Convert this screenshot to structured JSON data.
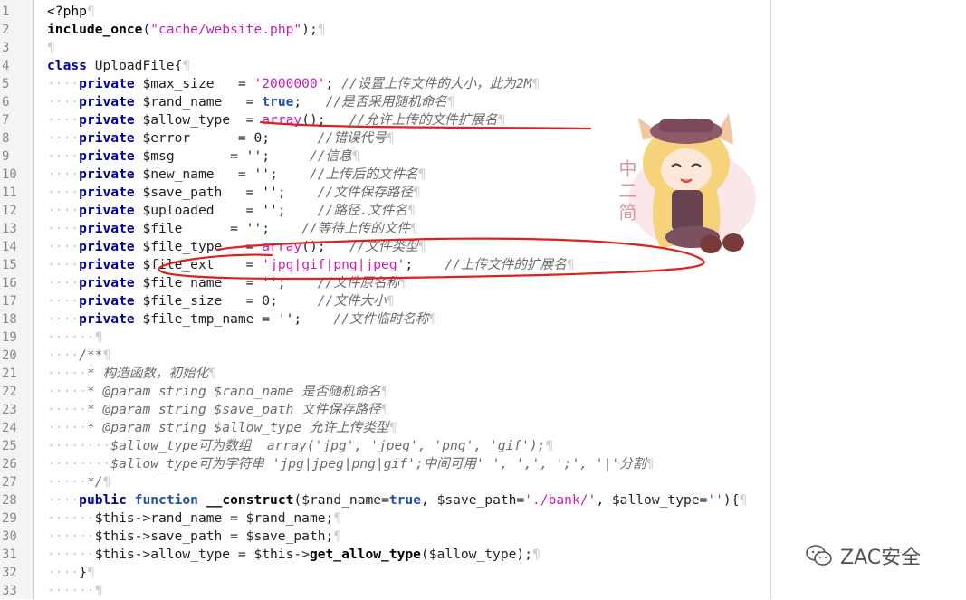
{
  "editor": {
    "lines": [
      {
        "n": "1",
        "segs": [
          [
            "tag",
            "<?php"
          ],
          [
            "pil",
            "¶"
          ]
        ]
      },
      {
        "n": "2",
        "segs": [
          [
            "fn",
            "include_once"
          ],
          [
            "pl",
            "("
          ],
          [
            "str",
            "\"cache/website.php\""
          ],
          [
            "pl",
            ");"
          ],
          [
            "pil",
            "¶"
          ]
        ]
      },
      {
        "n": "3",
        "segs": [
          [
            "pil",
            "¶"
          ]
        ]
      },
      {
        "n": "4",
        "segs": [
          [
            "kw",
            "class"
          ],
          [
            "pl",
            " UploadFile{"
          ],
          [
            "pil",
            "¶"
          ]
        ]
      },
      {
        "n": "5",
        "segs": [
          [
            "ind",
            "····"
          ],
          [
            "kw",
            "private"
          ],
          [
            "pl",
            " $max_size   = "
          ],
          [
            "str",
            "'2000000'"
          ],
          [
            "pl",
            "; "
          ],
          [
            "cmt",
            "//设置上传文件的大小，此为2M"
          ],
          [
            "pil",
            "¶"
          ]
        ]
      },
      {
        "n": "6",
        "segs": [
          [
            "ind",
            "····"
          ],
          [
            "kw",
            "private"
          ],
          [
            "pl",
            " $rand_name   = "
          ],
          [
            "bool",
            "true"
          ],
          [
            "pl",
            ";   "
          ],
          [
            "cmt",
            "//是否采用随机命名"
          ],
          [
            "pil",
            "¶"
          ]
        ]
      },
      {
        "n": "7",
        "segs": [
          [
            "ind",
            "····"
          ],
          [
            "kw",
            "private"
          ],
          [
            "pl",
            " $allow_type  = "
          ],
          [
            "str",
            "array"
          ],
          [
            "pl",
            "();   "
          ],
          [
            "cmt",
            "//允许上传的文件扩展名"
          ],
          [
            "pil",
            "¶"
          ]
        ]
      },
      {
        "n": "8",
        "segs": [
          [
            "ind",
            "····"
          ],
          [
            "kw",
            "private"
          ],
          [
            "pl",
            " $error      = 0;      "
          ],
          [
            "cmt",
            "//错误代号"
          ],
          [
            "pil",
            "¶"
          ]
        ]
      },
      {
        "n": "9",
        "segs": [
          [
            "ind",
            "····"
          ],
          [
            "kw",
            "private"
          ],
          [
            "pl",
            " $msg       = '';     "
          ],
          [
            "cmt",
            "//信息"
          ],
          [
            "pil",
            "¶"
          ]
        ]
      },
      {
        "n": "10",
        "segs": [
          [
            "ind",
            "····"
          ],
          [
            "kw",
            "private"
          ],
          [
            "pl",
            " $new_name   = '';    "
          ],
          [
            "cmt",
            "//上传后的文件名"
          ],
          [
            "pil",
            "¶"
          ]
        ]
      },
      {
        "n": "11",
        "segs": [
          [
            "ind",
            "····"
          ],
          [
            "kw",
            "private"
          ],
          [
            "pl",
            " $save_path   = '';    "
          ],
          [
            "cmt",
            "//文件保存路径"
          ],
          [
            "pil",
            "¶"
          ]
        ]
      },
      {
        "n": "12",
        "segs": [
          [
            "ind",
            "····"
          ],
          [
            "kw",
            "private"
          ],
          [
            "pl",
            " $uploaded    = '';    "
          ],
          [
            "cmt",
            "//路径.文件名"
          ],
          [
            "pil",
            "¶"
          ]
        ]
      },
      {
        "n": "13",
        "segs": [
          [
            "ind",
            "····"
          ],
          [
            "kw",
            "private"
          ],
          [
            "pl",
            " $file      = '';    "
          ],
          [
            "cmt",
            "//等待上传的文件"
          ],
          [
            "pil",
            "¶"
          ]
        ]
      },
      {
        "n": "14",
        "segs": [
          [
            "ind",
            "····"
          ],
          [
            "kw",
            "private"
          ],
          [
            "pl",
            " $file_type   = "
          ],
          [
            "str",
            "array"
          ],
          [
            "pl",
            "();   "
          ],
          [
            "cmt",
            "//文件类型"
          ],
          [
            "pil",
            "¶"
          ]
        ]
      },
      {
        "n": "15",
        "segs": [
          [
            "ind",
            "····"
          ],
          [
            "kw",
            "private"
          ],
          [
            "pl",
            " $file_ext    = "
          ],
          [
            "str",
            "'jpg|gif|png|jpeg'"
          ],
          [
            "pl",
            ";    "
          ],
          [
            "cmt",
            "//上传文件的扩展名"
          ],
          [
            "pil",
            "¶"
          ]
        ]
      },
      {
        "n": "16",
        "segs": [
          [
            "ind",
            "····"
          ],
          [
            "kw",
            "private"
          ],
          [
            "pl",
            " $file_name   = '';    "
          ],
          [
            "cmt",
            "//文件原名称"
          ],
          [
            "pil",
            "¶"
          ]
        ]
      },
      {
        "n": "17",
        "segs": [
          [
            "ind",
            "····"
          ],
          [
            "kw",
            "private"
          ],
          [
            "pl",
            " $file_size   = 0;     "
          ],
          [
            "cmt",
            "//文件大小"
          ],
          [
            "pil",
            "¶"
          ]
        ]
      },
      {
        "n": "18",
        "segs": [
          [
            "ind",
            "····"
          ],
          [
            "kw",
            "private"
          ],
          [
            "pl",
            " $file_tmp_name = '';    "
          ],
          [
            "cmt",
            "//文件临时名称"
          ],
          [
            "pil",
            "¶"
          ]
        ]
      },
      {
        "n": "19",
        "segs": [
          [
            "ind",
            "······"
          ],
          [
            "pil",
            "¶"
          ]
        ]
      },
      {
        "n": "20",
        "segs": [
          [
            "ind",
            "····"
          ],
          [
            "cmt",
            "/**"
          ],
          [
            "pil",
            "¶"
          ]
        ]
      },
      {
        "n": "21",
        "segs": [
          [
            "ind",
            "·····"
          ],
          [
            "cmt",
            "* 构造函数，初始化"
          ],
          [
            "pil",
            "¶"
          ]
        ]
      },
      {
        "n": "22",
        "segs": [
          [
            "ind",
            "·····"
          ],
          [
            "cmt",
            "* @param string $rand_name 是否随机命名"
          ],
          [
            "pil",
            "¶"
          ]
        ]
      },
      {
        "n": "23",
        "segs": [
          [
            "ind",
            "·····"
          ],
          [
            "cmt",
            "* @param string $save_path 文件保存路径"
          ],
          [
            "pil",
            "¶"
          ]
        ]
      },
      {
        "n": "24",
        "segs": [
          [
            "ind",
            "·····"
          ],
          [
            "cmt",
            "* @param string $allow_type 允许上传类型"
          ],
          [
            "pil",
            "¶"
          ]
        ]
      },
      {
        "n": "25",
        "segs": [
          [
            "ind",
            "········"
          ],
          [
            "cmt",
            "$allow_type可为数组  array('jpg', 'jpeg', 'png', 'gif');"
          ],
          [
            "pil",
            "¶"
          ]
        ]
      },
      {
        "n": "26",
        "segs": [
          [
            "ind",
            "········"
          ],
          [
            "cmt",
            "$allow_type可为字符串 'jpg|jpeg|png|gif';中间可用' ', ',', ';', '|'分割"
          ],
          [
            "pil",
            "¶"
          ]
        ]
      },
      {
        "n": "27",
        "segs": [
          [
            "ind",
            "·····"
          ],
          [
            "cmt",
            "*/"
          ],
          [
            "pil",
            "¶"
          ]
        ]
      },
      {
        "n": "28",
        "segs": [
          [
            "ind",
            "····"
          ],
          [
            "kw",
            "public"
          ],
          [
            "pl",
            " "
          ],
          [
            "bool",
            "function"
          ],
          [
            "pl",
            " "
          ],
          [
            "fn",
            "__construct"
          ],
          [
            "pl",
            "($rand_name="
          ],
          [
            "bool",
            "true"
          ],
          [
            "pl",
            ", $save_path="
          ],
          [
            "str",
            "'./bank/'"
          ],
          [
            "pl",
            ", $allow_type="
          ],
          [
            "str",
            "''"
          ],
          [
            "pl",
            "){"
          ],
          [
            "pil",
            "¶"
          ]
        ]
      },
      {
        "n": "29",
        "segs": [
          [
            "ind",
            "······"
          ],
          [
            "pl",
            "$this->rand_name = $rand_name;"
          ],
          [
            "pil",
            "¶"
          ]
        ]
      },
      {
        "n": "30",
        "segs": [
          [
            "ind",
            "······"
          ],
          [
            "pl",
            "$this->save_path = $save_path;"
          ],
          [
            "pil",
            "¶"
          ]
        ]
      },
      {
        "n": "31",
        "segs": [
          [
            "ind",
            "······"
          ],
          [
            "pl",
            "$this->allow_type = $this->"
          ],
          [
            "fn",
            "get_allow_type"
          ],
          [
            "pl",
            "($allow_type);"
          ],
          [
            "pil",
            "¶"
          ]
        ]
      },
      {
        "n": "32",
        "segs": [
          [
            "ind",
            "····"
          ],
          [
            "pl",
            "}"
          ],
          [
            "pil",
            "¶"
          ]
        ]
      },
      {
        "n": "33",
        "segs": [
          [
            "ind",
            "······"
          ],
          [
            "pil",
            "¶"
          ]
        ]
      }
    ]
  },
  "mascot": {
    "caption": "中二简"
  },
  "watermark": {
    "text": "ZAC安全",
    "icon": "wechat-icon"
  },
  "colors": {
    "annotation": "#e0201b",
    "keyword": "#00009a",
    "string": "#c81eb5",
    "comment": "#6b6b6b"
  }
}
